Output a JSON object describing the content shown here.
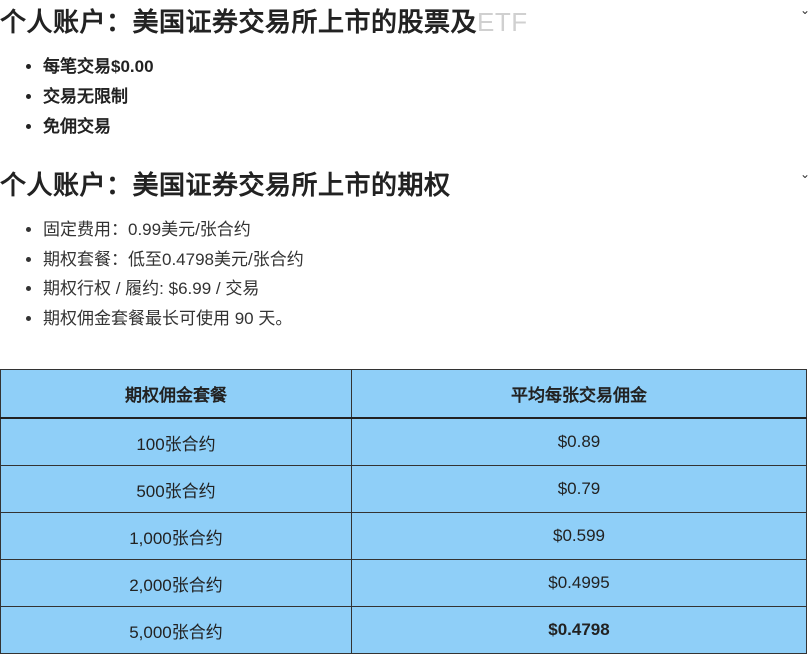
{
  "section1": {
    "heading": "个人账户：美国证券交易所上市的股票及",
    "heading_suffix": "ETF",
    "items": [
      "每笔交易$0.00",
      "交易无限制",
      "免佣交易"
    ]
  },
  "section2": {
    "heading": "个人账户：美国证券交易所上市的期权",
    "items": [
      "固定费用：0.99美元/张合约",
      "期权套餐：低至0.4798美元/张合约",
      "期权行权 / 履约: $6.99 / 交易",
      "期权佣金套餐最长可使用 90 天。"
    ]
  },
  "table": {
    "headers": [
      "期权佣金套餐",
      "平均每张交易佣金"
    ],
    "rows": [
      [
        "100张合约",
        "$0.89"
      ],
      [
        "500张合约",
        "$0.79"
      ],
      [
        "1,000张合约",
        "$0.599"
      ],
      [
        "2,000张合约",
        "$0.4995"
      ],
      [
        "5,000张合约",
        "$0.4798"
      ]
    ]
  },
  "colors": {
    "table_background": "#8fcff8",
    "heading_text": "#222222",
    "faded_text": "#d0d0d0"
  },
  "icons": [
    "chevron-down-icon"
  ]
}
